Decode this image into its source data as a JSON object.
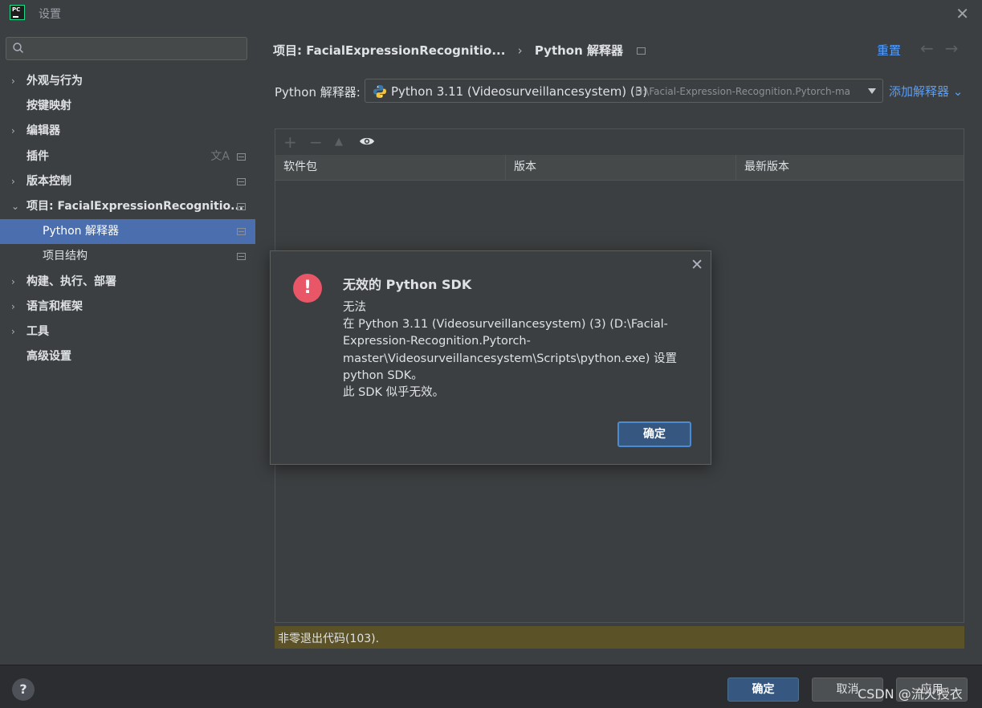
{
  "window": {
    "title": "设置"
  },
  "search": {
    "placeholder": ""
  },
  "sidebar": {
    "items": [
      {
        "label": "外观与行为",
        "arrow": "›"
      },
      {
        "label": "按键映射"
      },
      {
        "label": "编辑器",
        "arrow": "›"
      },
      {
        "label": "插件"
      },
      {
        "label": "版本控制",
        "arrow": "›"
      },
      {
        "label": "项目: FacialExpressionRecognitio...",
        "arrow": "⌄"
      },
      {
        "label": "Python 解释器"
      },
      {
        "label": "项目结构"
      },
      {
        "label": "构建、执行、部署",
        "arrow": "›"
      },
      {
        "label": "语言和框架",
        "arrow": "›"
      },
      {
        "label": "工具",
        "arrow": "›"
      },
      {
        "label": "高级设置"
      }
    ],
    "selected_index": 6
  },
  "header": {
    "breadcrumb": [
      "项目: FacialExpressionRecognitio...",
      "Python 解释器"
    ],
    "separator": "›",
    "reset_label": "重置"
  },
  "interpreter": {
    "label": "Python 解释器:",
    "value": "Python 3.11 (Videosurveillancesystem) (3)",
    "path": "D:\\Facial-Expression-Recognition.Pytorch-ma",
    "add_label": "添加解释器 ⌄"
  },
  "packages": {
    "toolbar": {
      "add": "+",
      "remove": "−",
      "up": "▲"
    },
    "columns": [
      "软件包",
      "版本",
      "最新版本"
    ]
  },
  "status": {
    "message": "非零退出代码(103)."
  },
  "dialog": {
    "title": "无效的 Python SDK",
    "lines": [
      "无法",
      "在 Python 3.11 (Videosurveillancesystem) (3) (D:\\Facial-",
      "Expression-Recognition.Pytorch-",
      "master\\Videosurveillancesystem\\Scripts\\python.exe) 设置",
      "python SDK。",
      "此 SDK 似乎无效。"
    ],
    "ok_label": "确定",
    "icon_glyph": "!"
  },
  "footer": {
    "help": "?",
    "ok_label": "确定",
    "cancel_label": "取消",
    "apply_label": "应用"
  },
  "watermark": "CSDN @流火授衣",
  "colors": {
    "accent": "#4b6eaf",
    "link": "#589df6",
    "error": "#e85668",
    "status_bg": "#5c5227"
  }
}
